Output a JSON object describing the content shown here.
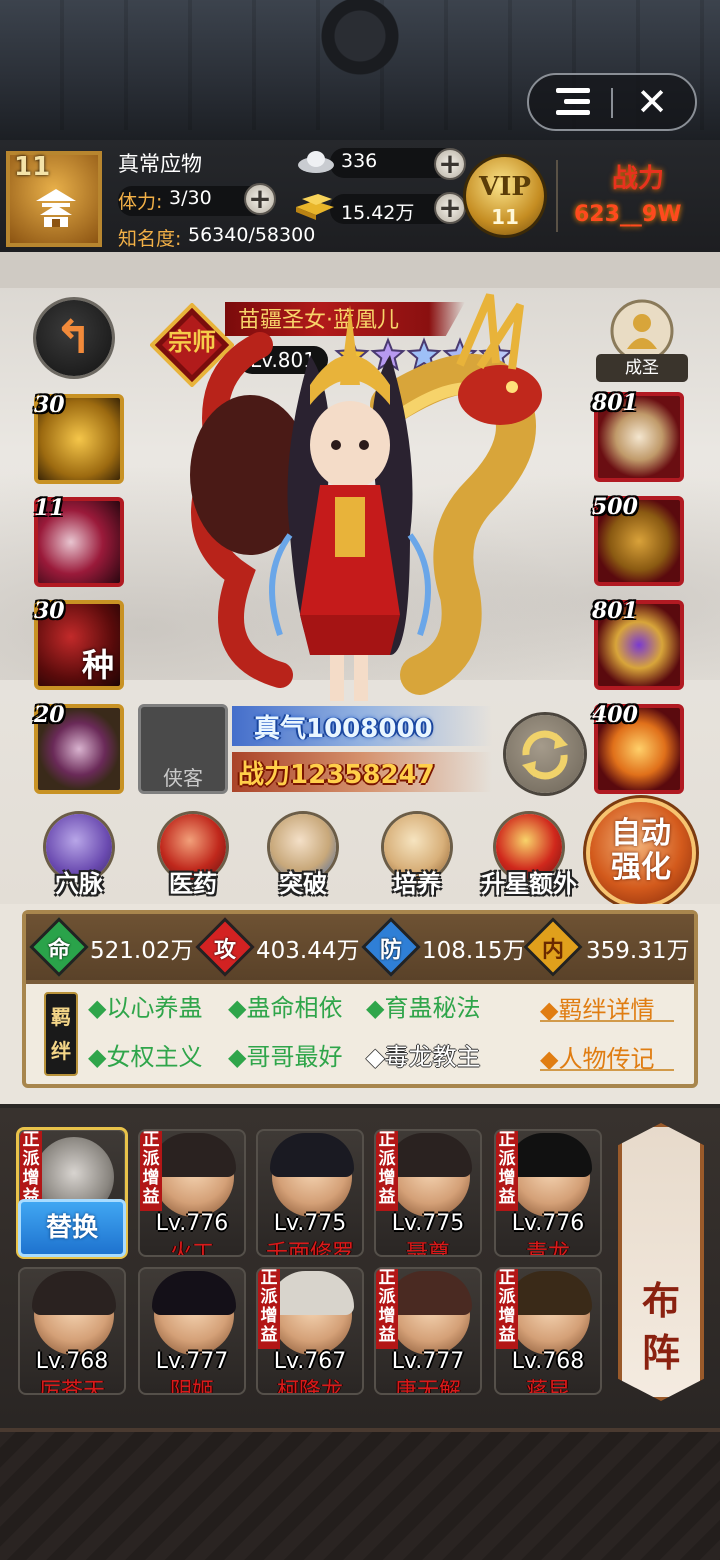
{
  "player": {
    "level": "11",
    "name": "真常应物",
    "stamina_label": "体力:",
    "stamina_value": "3/30",
    "fame_label": "知名度:",
    "fame_value": "56340/58300",
    "silver": "336",
    "gold": "15.42万",
    "vip_text": "VIP",
    "vip_level": "11",
    "power_label": "战力",
    "power_value": "623__9W"
  },
  "hero": {
    "rank": "宗师",
    "name": "苗疆圣女·蓝凰儿",
    "level": "Lv.801",
    "stars": 5,
    "achieve_label": "成圣",
    "qi_text": "真气1008000",
    "power_text": "战力12358247",
    "xiake_label": "侠客"
  },
  "left_slots": [
    {
      "num": "30",
      "icon": "gold-swirl-icon"
    },
    {
      "num": "11",
      "icon": "skull-icon"
    },
    {
      "num": "30",
      "icon": "seed-icon",
      "char": "种"
    },
    {
      "num": "20",
      "icon": "gu-jar-icon"
    }
  ],
  "right_slots": [
    {
      "num": "801",
      "icon": "bone-weapon-icon"
    },
    {
      "num": "500",
      "icon": "armor-icon"
    },
    {
      "num": "801",
      "icon": "lantern-icon"
    },
    {
      "num": "400",
      "icon": "dragon-pet-icon"
    }
  ],
  "actions": [
    {
      "label": "穴脉",
      "icon": "meridian-icon"
    },
    {
      "label": "医药",
      "icon": "medicine-icon"
    },
    {
      "label": "突破",
      "icon": "breakthrough-icon"
    },
    {
      "label": "培养",
      "icon": "scroll-icon"
    },
    {
      "label": "升星额外",
      "icon": "star-up-icon"
    }
  ],
  "auto_strengthen": "自动强化",
  "stats": [
    {
      "char": "命",
      "value": "521.02万",
      "color": "#2aa34a"
    },
    {
      "char": "攻",
      "value": "403.44万",
      "color": "#d32222"
    },
    {
      "char": "防",
      "value": "108.15万",
      "color": "#2f7fd6"
    },
    {
      "char": "内",
      "value": "359.31万",
      "color": "#e0a01c"
    }
  ],
  "bond_seal": "羁绊",
  "bonds": [
    {
      "text": "◆以心养蛊",
      "active": true
    },
    {
      "text": "◆蛊命相依",
      "active": true
    },
    {
      "text": "◆育蛊秘法",
      "active": true
    },
    {
      "text": "◆女权主义",
      "active": true
    },
    {
      "text": "◆哥哥最好",
      "active": true
    },
    {
      "text": "◆毒龙教主",
      "active": false
    }
  ],
  "bond_detail": "◆羁绊详情",
  "biography": "◆人物传记",
  "team": [
    {
      "level": "",
      "name": "",
      "tag": "正派增益"
    },
    {
      "level": "Lv.776",
      "name": "火工",
      "tag": "正派增益"
    },
    {
      "level": "Lv.775",
      "name": "千面修罗",
      "tag": ""
    },
    {
      "level": "Lv.775",
      "name": "聂尊",
      "tag": "正派增益"
    },
    {
      "level": "Lv.776",
      "name": "青龙",
      "tag": "正派增益"
    },
    {
      "level": "Lv.768",
      "name": "厉苍天",
      "tag": ""
    },
    {
      "level": "Lv.777",
      "name": "阴姬",
      "tag": ""
    },
    {
      "level": "Lv.767",
      "name": "柯降龙",
      "tag": "正派增益"
    },
    {
      "level": "Lv.777",
      "name": "唐无解",
      "tag": "正派增益"
    },
    {
      "level": "Lv.768",
      "name": "蒋昆",
      "tag": "正派增益"
    }
  ],
  "replace_label": "替换",
  "formation_label": "布阵"
}
